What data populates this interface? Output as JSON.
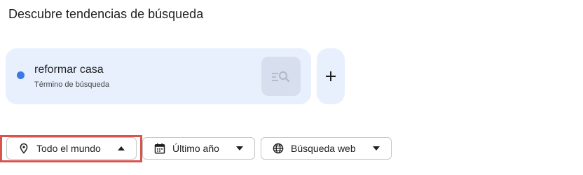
{
  "page": {
    "title": "Descubre tendencias de búsqueda"
  },
  "term_card": {
    "name": "reformar casa",
    "type": "Término de búsqueda",
    "dot_color": "#3c78e6",
    "explore_icon": "search-list-icon"
  },
  "add_button": {
    "icon": "plus-icon"
  },
  "filters": {
    "location": {
      "label": "Todo el mundo",
      "icon": "location-pin-icon",
      "arrow": "caret-up-icon",
      "expanded": true
    },
    "time": {
      "label": "Último año",
      "icon": "calendar-icon",
      "arrow": "caret-down-icon"
    },
    "search_type": {
      "label": "Búsqueda web",
      "icon": "globe-icon",
      "arrow": "caret-down-icon"
    }
  },
  "colors": {
    "card_background": "#e8f0fe",
    "highlight": "#d9534f"
  }
}
